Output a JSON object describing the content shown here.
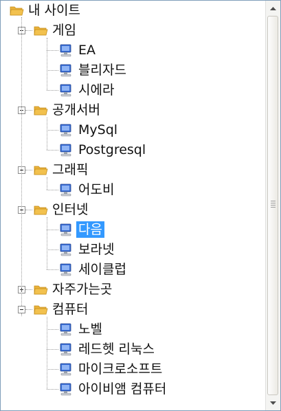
{
  "tree": {
    "root": {
      "label": "내 사이트",
      "icon": "folder-icon"
    },
    "groups": [
      {
        "label": "게임",
        "icon": "folder-icon",
        "expanded": true,
        "children": [
          "EA",
          "블리자드",
          "시에라"
        ]
      },
      {
        "label": "공개서버",
        "icon": "folder-icon",
        "expanded": true,
        "children": [
          "MySql",
          "Postgresql"
        ]
      },
      {
        "label": "그래픽",
        "icon": "folder-icon",
        "expanded": true,
        "children": [
          "어도비"
        ]
      },
      {
        "label": "인터넷",
        "icon": "folder-icon",
        "expanded": true,
        "children": [
          "다음",
          "보라넷",
          "세이클럽"
        ]
      },
      {
        "label": "자주가는곳",
        "icon": "folder-icon",
        "expanded": false,
        "children": []
      },
      {
        "label": "컴퓨터",
        "icon": "folder-icon",
        "expanded": true,
        "children": [
          "노벨",
          "레드헷 리눅스",
          "마이크로소프트",
          "아이비앰 컴퓨터"
        ]
      }
    ],
    "selected": "다음",
    "leaf_icon": "computer-icon"
  },
  "scrollbar": {
    "up_icon": "scroll-up-arrow-icon",
    "down_icon": "scroll-down-arrow-icon"
  },
  "colors": {
    "selection": "#3399ff",
    "border": "#7f9db9",
    "folder": "#f2c14e",
    "monitor": "#3b6fd6"
  }
}
